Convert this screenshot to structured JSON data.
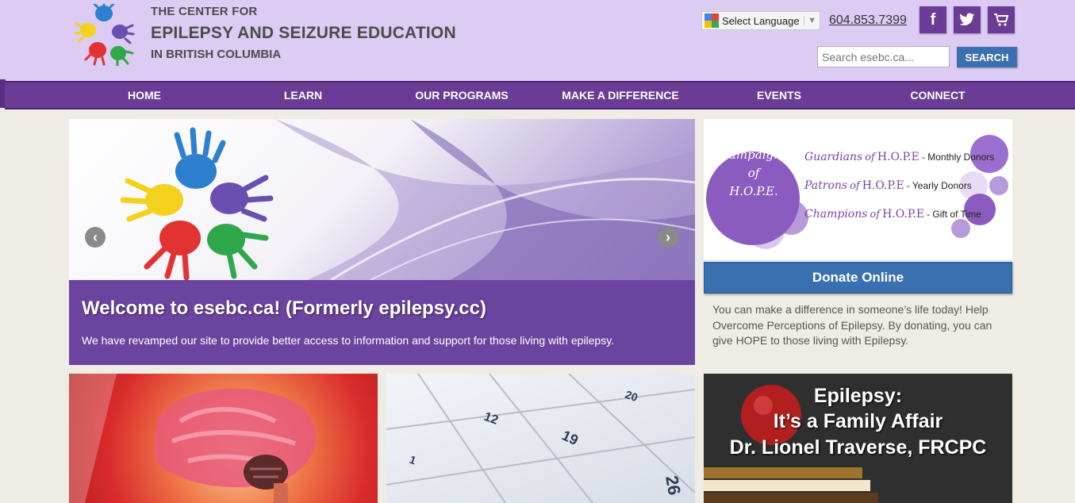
{
  "header": {
    "org_line1": "THE CENTER FOR",
    "org_line2": "EPILEPSY AND SEIZURE EDUCATION",
    "org_line3": "IN BRITISH COLUMBIA",
    "language_label": "Select Language",
    "phone": "604.853.7399",
    "search_placeholder": "Search esebc.ca...",
    "search_button": "SEARCH"
  },
  "nav": [
    {
      "label": "HOME"
    },
    {
      "label": "LEARN"
    },
    {
      "label": "OUR PROGRAMS"
    },
    {
      "label": "MAKE A DIFFERENCE"
    },
    {
      "label": "EVENTS"
    },
    {
      "label": "CONNECT"
    }
  ],
  "hero": {
    "title": "Welcome to esebc.ca! (Formerly epilepsy.cc)",
    "text": "We have revamped our site to provide better access to information and support for those living with epilepsy."
  },
  "hope": {
    "circle_line1": "Campaigns",
    "circle_line2": "of",
    "circle_line3": "H.O.P.E.",
    "rows": [
      {
        "label": "Guardians",
        "of": "of",
        "hope": "H.O.P.E",
        "desc": "- Monthly Donors"
      },
      {
        "label": "Patrons",
        "of": "of",
        "hope": "H.O.P.E",
        "desc": "- Yearly Donors"
      },
      {
        "label": "Champions",
        "of": "of",
        "hope": "H.O.P.E",
        "desc": "- Gift of Time"
      }
    ]
  },
  "donate": {
    "button": "Donate Online",
    "text": "You can make a difference in someone’s life today! Help Overcome Perceptions of Epilepsy. By donating, you can give HOPE to those living with Epilepsy."
  },
  "tiles": {
    "calendar_numbers": [
      "12",
      "20",
      "19",
      "26",
      "1"
    ],
    "apple_line1": "Epilepsy:",
    "apple_line2": "It’s a Family Affair",
    "apple_line3": "Dr. Lionel Traverse, FRCPC"
  },
  "colors": {
    "header_bg": "#dccbf2",
    "nav_bg": "#6a3c96",
    "accent_blue": "#3a6fb0",
    "caption_bg": "#6a449f"
  }
}
